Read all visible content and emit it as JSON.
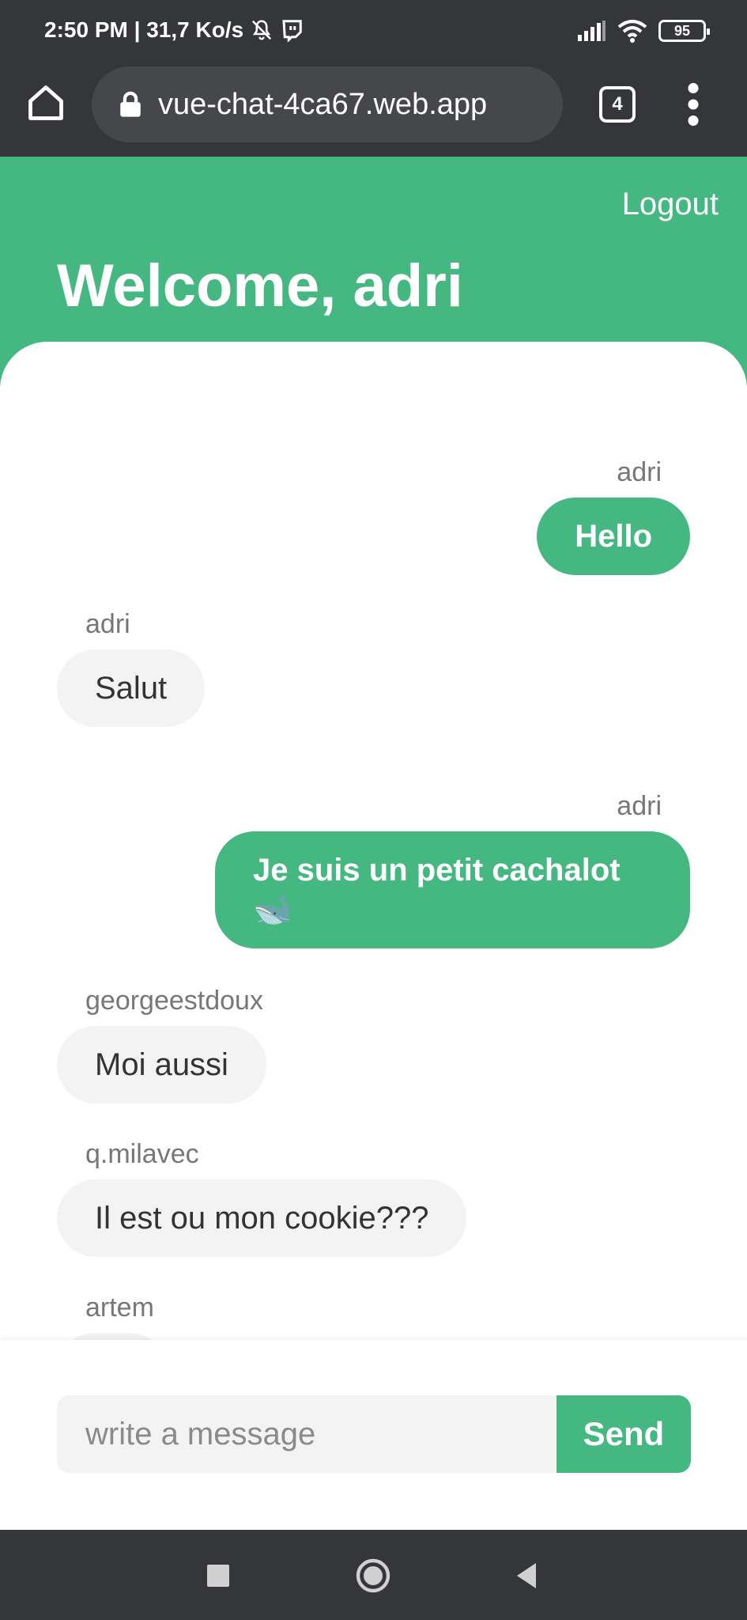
{
  "status_bar": {
    "time_and_speed": "2:50 PM | 31,7 Ko/s",
    "battery": "95"
  },
  "browser": {
    "url": "vue-chat-4ca67.web.app",
    "tab_count": "4"
  },
  "header": {
    "logout_label": "Logout",
    "welcome": "Welcome, adri"
  },
  "messages": [
    {
      "author": "adri",
      "text": "Hello",
      "mine": true
    },
    {
      "author": "adri",
      "text": "Salut",
      "mine": false
    },
    {
      "author": "adri",
      "text": "Je suis un petit cachalot 🐋",
      "mine": true
    },
    {
      "author": "georgeestdoux",
      "text": "Moi aussi",
      "mine": false
    },
    {
      "author": "q.milavec",
      "text": "Il est ou mon cookie???",
      "mine": false
    },
    {
      "author": "artem",
      "text": "",
      "mine": false
    }
  ],
  "composer": {
    "placeholder": "write a message",
    "send_label": "Send"
  },
  "colors": {
    "accent": "#45b882",
    "chrome": "#35363a"
  }
}
